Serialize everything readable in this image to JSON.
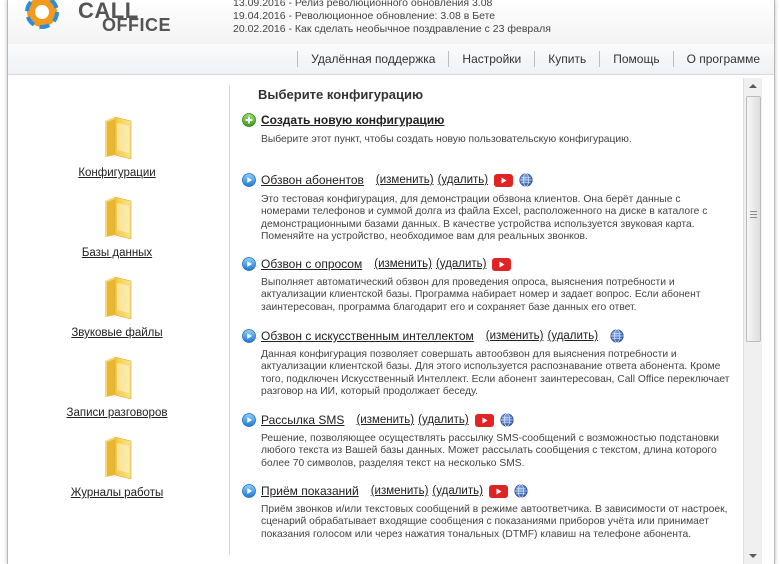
{
  "header": {
    "logo_line1": "CALL",
    "logo_line2": "OFFICE",
    "news": [
      "13.09.2016 - Релиз революционного обновления 3.08",
      "19.04.2016 - Революционное обновление: 3.08 в Бете",
      "20.02.2016 - Как сделать необычное поздравление с 23 февраля"
    ]
  },
  "nav": {
    "items": [
      "Удалённая поддержка",
      "Настройки",
      "Купить",
      "Помощь",
      "О программе"
    ]
  },
  "sidebar": {
    "items": [
      {
        "label": "Конфигурации"
      },
      {
        "label": "Базы данных"
      },
      {
        "label": "Звуковые файлы"
      },
      {
        "label": "Записи разговоров"
      },
      {
        "label": "Журналы работы"
      }
    ]
  },
  "content": {
    "title": "Выберите конфигурацию",
    "create": {
      "label": "Создать новую конфигурацию",
      "desc": "Выберите этот пункт, чтобы создать новую пользовательскую конфигурацию."
    },
    "edit_label": "(изменить)",
    "delete_label": "(удалить)",
    "configs": [
      {
        "name": "Обзвон абонентов",
        "desc": "Это тестовая конфигурация, для демонстрации обзвона клиентов. Она берёт данные с номерами телефонов и суммой долга из файла Excel, расположенного на диске в каталоге с демонстрационными базами данных. В качестве устройства используется звуковая карта. Поменяйте на устройство, необходимое вам для реальных звонков."
      },
      {
        "name": "Обзвон с опросом",
        "desc": "Выполняет автоматический обзвон для проведения опроса, выяснения потребности и актуализации клиентской базы. Программа набирает номер и задает вопрос. Если абонент заинтересован, программа благодарит его и сохраняет базе данных его ответ."
      },
      {
        "name": "Обзвон с искусственным интеллектом",
        "desc": "Данная конфигурация позволяет совершать автообзвон для выяснения потребности и актуализации клиентской базы. Для этого используется распознавание ответа абонента. Кроме того, подключен Искусственный Интеллект. Если абонент заинтересован, Call Office переключает разговор на ИИ, который продолжает беседу."
      },
      {
        "name": "Рассылка SMS",
        "desc": "Решение, позволяющее осуществлять рассылку SMS-сообщений с возможностью подстановки любого текста из Вашей базы данных. Может рассылать сообщения с текстом, длина которого более 70 символов, разделяя текст на несколько SMS."
      },
      {
        "name": "Приём показаний",
        "desc": "Приём звонков и/или текстовых сообщений в режиме автоответчика. В зависимости от настроек, сценарий обрабатывает входящие сообщения с показаниями приборов учёта или принимает показания голосом или через нажатия тональных (DTMF) клавиш на телефоне абонента."
      }
    ]
  },
  "colors": {
    "logo_orange": "#f39a1e",
    "logo_blue": "#2a8fd8",
    "folder_yellow": "#f6cf55",
    "youtube_red": "#e02424",
    "play_blue": "#2f8fe0",
    "plus_green": "#4aa52a"
  },
  "icons": [
    "logo-icon",
    "folder-icon",
    "plus-circle-icon",
    "play-circle-icon",
    "youtube-icon",
    "globe-icon"
  ]
}
